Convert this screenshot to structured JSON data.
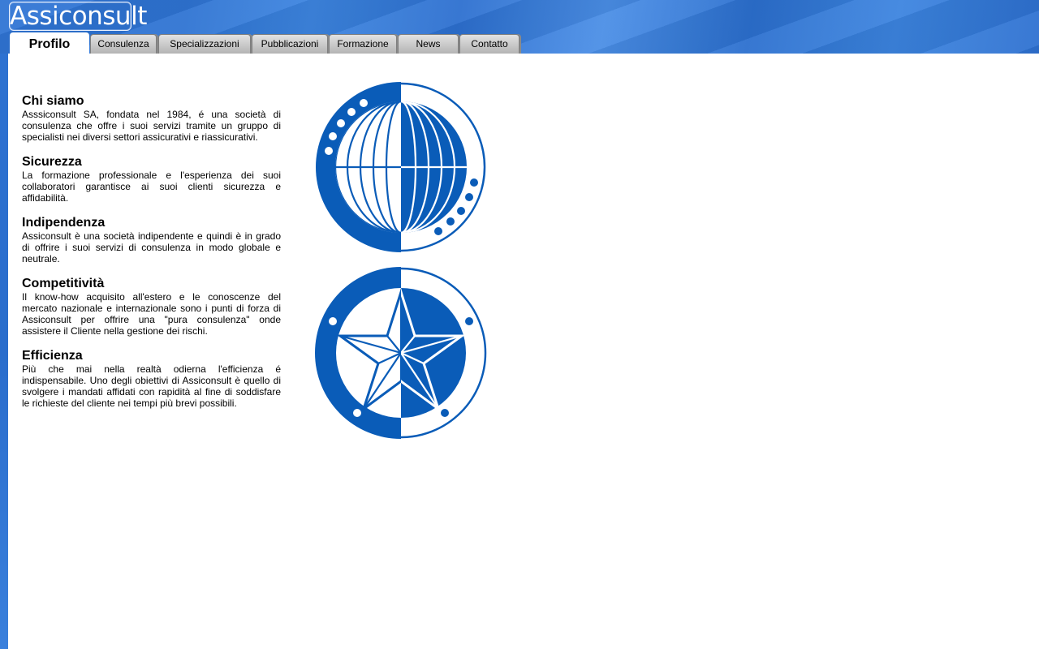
{
  "logo": {
    "text": "Assiconsult"
  },
  "nav": {
    "tabs": [
      {
        "label": "Profilo",
        "active": true
      },
      {
        "label": "Consulenza",
        "active": false
      },
      {
        "label": "Specializzazioni",
        "active": false
      },
      {
        "label": "Pubblicazioni",
        "active": false
      },
      {
        "label": "Formazione",
        "active": false
      },
      {
        "label": "News",
        "active": false
      },
      {
        "label": "Contatto",
        "active": false
      }
    ]
  },
  "sections": [
    {
      "heading": "Chi siamo",
      "text": "Asssiconsult SA, fondata nel 1984, é una società di consulenza che offre i suoi servizi tramite un gruppo di specialisti nei diversi settori assicurativi e riassicurativi."
    },
    {
      "heading": "Sicurezza",
      "text": "La formazione professionale e l'esperienza dei suoi collaboratori garantisce ai suoi clienti sicurezza e affidabilità."
    },
    {
      "heading": "Indipendenza",
      "text": "Assiconsult è una società indipendente e quindi è in grado di offrire i suoi servizi di consulenza in modo globale e neutrale."
    },
    {
      "heading": "Competitività",
      "text": "Il know-how acquisito all'estero e le conoscenze del mercato nazionale e internazionale sono i punti di forza di Assiconsult per offrire una \"pura consulenza\" onde assistere il Cliente nella gestione dei rischi."
    },
    {
      "heading": "Efficienza",
      "text": "Più che mai nella realtà odierna l'efficienza é indispensabile. Uno degli obiettivi di Assiconsult è quello di svolgere i mandati affidati con rapidità al fine di soddisfare le richieste del cliente nei tempi più brevi possibili."
    }
  ],
  "images": [
    {
      "name": "globe-emblem-icon"
    },
    {
      "name": "star-emblem-icon"
    }
  ],
  "colors": {
    "brand_blue": "#0a5cb8",
    "banner_blue": "#2f74d4"
  }
}
